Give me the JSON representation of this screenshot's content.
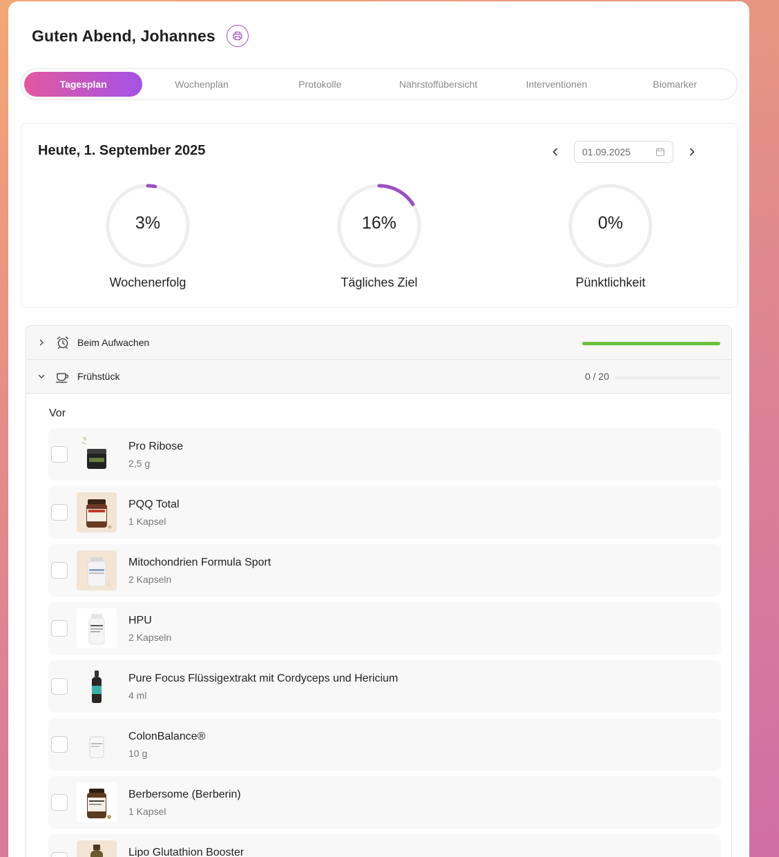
{
  "header": {
    "greeting": "Guten Abend, Johannes",
    "print_icon": "printer-icon"
  },
  "tabs": [
    {
      "label": "Tagesplan",
      "active": true
    },
    {
      "label": "Wochenplan",
      "active": false
    },
    {
      "label": "Protokolle",
      "active": false
    },
    {
      "label": "Nährstoffübersicht",
      "active": false
    },
    {
      "label": "Interventionen",
      "active": false
    },
    {
      "label": "Biomarker",
      "active": false
    }
  ],
  "colors": {
    "accent_start": "#e2589f",
    "accent_end": "#a453e6",
    "progress_green": "#68c23a",
    "ring_purple": "#9b4fc4"
  },
  "day": {
    "title": "Heute, 1. September 2025",
    "date_value": "01.09.2025",
    "gauges": [
      {
        "percent_text": "3%",
        "fraction": 0.03,
        "label": "Wochenerfolg"
      },
      {
        "percent_text": "16%",
        "fraction": 0.16,
        "label": "Tägliches Ziel"
      },
      {
        "percent_text": "0%",
        "fraction": 0.0,
        "label": "Pünktlichkeit"
      }
    ]
  },
  "sections": {
    "wake": {
      "title": "Beim Aufwachen",
      "icon": "alarm-clock-icon",
      "expanded": false,
      "progress_fraction": 1.0
    },
    "breakfast": {
      "title": "Frühstück",
      "icon": "coffee-cup-icon",
      "expanded": true,
      "count": "0 / 20",
      "progress_fraction": 0.0
    }
  },
  "group_label": "Vor",
  "items": [
    {
      "name": "Pro Ribose",
      "dose": "2,5 g"
    },
    {
      "name": "PQQ Total",
      "dose": "1 Kapsel"
    },
    {
      "name": "Mitochondrien Formula Sport",
      "dose": "2 Kapseln"
    },
    {
      "name": "HPU",
      "dose": "2 Kapseln"
    },
    {
      "name": "Pure Focus Flüssigextrakt mit Cordyceps und Hericium",
      "dose": "4 ml"
    },
    {
      "name": "ColonBalance®",
      "dose": "10 g"
    },
    {
      "name": "Berbersome (Berberin)",
      "dose": "1 Kapsel"
    },
    {
      "name": "Lipo Glutathion Booster",
      "dose": ""
    }
  ]
}
